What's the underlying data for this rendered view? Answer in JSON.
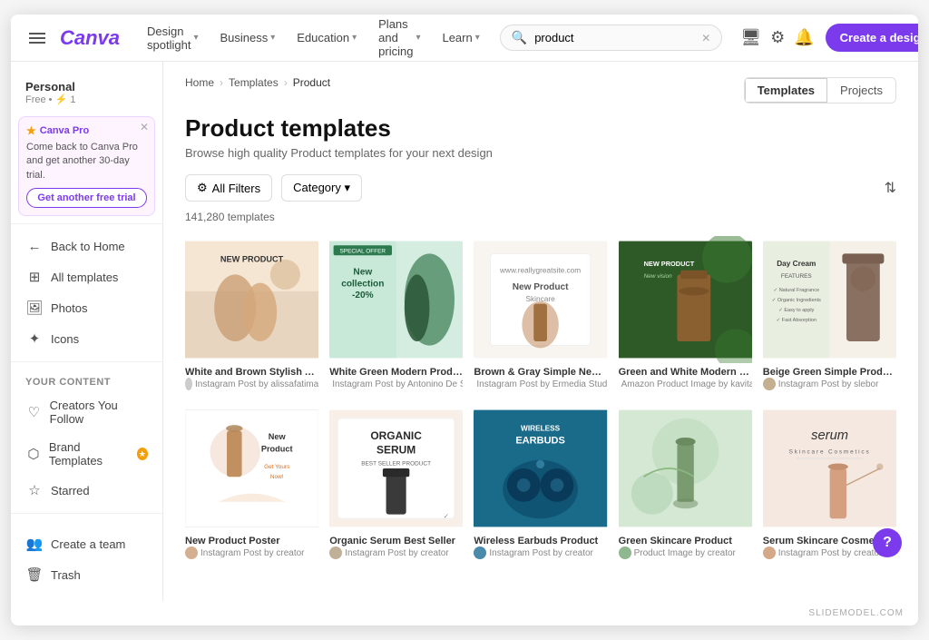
{
  "nav": {
    "logo": "Canva",
    "hamburger_label": "Menu",
    "links": [
      {
        "label": "Design spotlight",
        "id": "design-spotlight"
      },
      {
        "label": "Business",
        "id": "business"
      },
      {
        "label": "Education",
        "id": "education"
      },
      {
        "label": "Plans and pricing",
        "id": "plans-pricing"
      },
      {
        "label": "Learn",
        "id": "learn"
      }
    ],
    "search": {
      "placeholder": "product",
      "value": "product"
    },
    "create_btn": "Create a design"
  },
  "sidebar": {
    "user": {
      "name": "Personal",
      "plan": "Free • ⚡ 1"
    },
    "pro_banner": {
      "badge": "Canva Pro",
      "text": "Come back to Canva Pro and get another 30-day trial.",
      "button": "Get another free trial"
    },
    "items": [
      {
        "label": "Back to Home",
        "icon": "←",
        "id": "back-home"
      },
      {
        "label": "All templates",
        "icon": "⊞",
        "id": "all-templates"
      },
      {
        "label": "Photos",
        "icon": "🖼",
        "id": "photos"
      },
      {
        "label": "Icons",
        "icon": "✦",
        "id": "icons"
      }
    ],
    "your_content_label": "Your Content",
    "content_items": [
      {
        "label": "Creators You Follow",
        "icon": "♡",
        "id": "creators"
      },
      {
        "label": "Brand Templates",
        "icon": "⬡",
        "id": "brand-templates",
        "badge": true
      },
      {
        "label": "Starred",
        "icon": "☆",
        "id": "starred"
      }
    ],
    "bottom_items": [
      {
        "label": "Create a team",
        "icon": "👥",
        "id": "create-team"
      },
      {
        "label": "Trash",
        "icon": "🗑",
        "id": "trash"
      }
    ]
  },
  "breadcrumb": {
    "items": [
      {
        "label": "Home",
        "id": "home"
      },
      {
        "label": "Templates",
        "id": "templates"
      },
      {
        "label": "Product",
        "id": "product"
      }
    ]
  },
  "content": {
    "toggle": {
      "options": [
        {
          "label": "Templates",
          "active": true
        },
        {
          "label": "Projects",
          "active": false
        }
      ]
    },
    "title": "Product templates",
    "subtitle": "Browse high quality Product templates for your next design",
    "filters": [
      {
        "label": "All Filters",
        "icon": "⚙"
      },
      {
        "label": "Category ▾",
        "icon": ""
      }
    ],
    "count": "141,280 templates",
    "templates": [
      {
        "name": "White and Brown Stylish Appliance...",
        "author": "Instagram Post by alissafatima",
        "style": "thumb-1",
        "label": "NEW PRODUCT"
      },
      {
        "name": "White Green Modern Product Mark...",
        "author": "Instagram Post by Antonino De Stefano",
        "style": "thumb-2",
        "label": "New collection -20%",
        "badge": "SPECIAL OFFER"
      },
      {
        "name": "Brown & Gray Simple New Skincare...",
        "author": "Instagram Post by Ermedia Studio",
        "style": "thumb-3",
        "label": "New Product Skincare"
      },
      {
        "name": "Green and White Modern Skincare ...",
        "author": "Amazon Product Image by kavitaws",
        "style": "thumb-4",
        "label": "NEW PRODUCT New vision"
      },
      {
        "name": "Beige Green Simple Product Featur...",
        "author": "Instagram Post by slebor",
        "style": "thumb-5",
        "label": "Day Cream FEATURES"
      },
      {
        "name": "New Product Poster",
        "author": "Instagram Post by creator",
        "style": "thumb-6",
        "label": "New Product Get Yours Now!"
      },
      {
        "name": "Organic Serum Best Seller",
        "author": "Instagram Post by creator",
        "style": "thumb-7",
        "label": "ORGANIC SERUM BEST SELLER PRODUCT"
      },
      {
        "name": "Wireless Earbuds Product",
        "author": "Instagram Post by creator",
        "style": "thumb-8",
        "label": "WIRELESS EARBUDS"
      },
      {
        "name": "Green Skincare Product",
        "author": "Product Image by creator",
        "style": "thumb-9",
        "label": ""
      },
      {
        "name": "Serum Skincare Cosmetics",
        "author": "Instagram Post by creator",
        "style": "thumb-10",
        "label": "serum Skincare Cosmetics"
      }
    ]
  },
  "footer": {
    "credit": "SLIDEMODEL.COM"
  }
}
